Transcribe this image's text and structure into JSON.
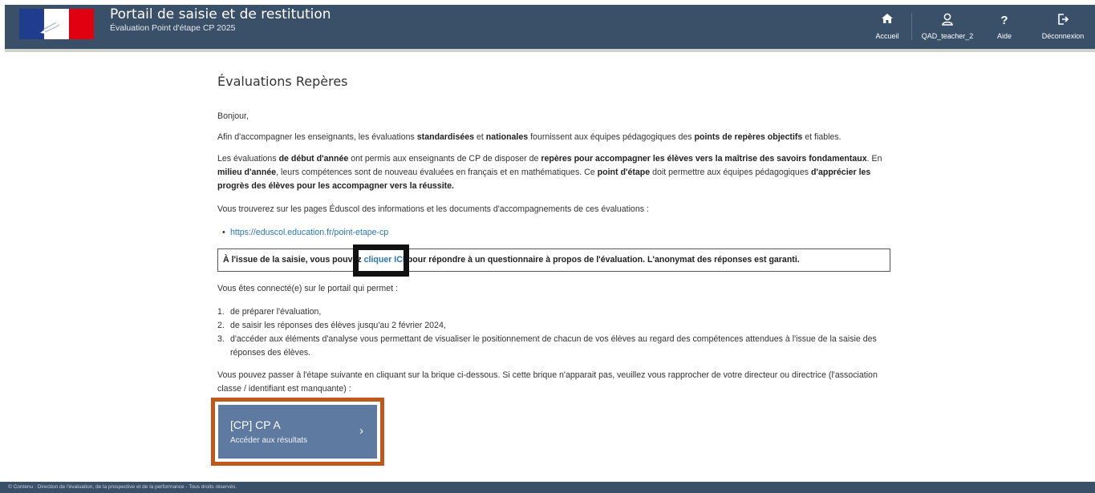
{
  "header": {
    "title": "Portail de saisie et de restitution",
    "subtitle": "Évaluation Point d'étape CP 2025",
    "nav": [
      {
        "label": "Accueil",
        "icon": "home-icon"
      },
      {
        "label": "QAD_teacher_2",
        "icon": "user-icon"
      },
      {
        "label": "Aide",
        "icon": "help-icon"
      },
      {
        "label": "Déconnexion",
        "icon": "logout-icon"
      }
    ],
    "colors": {
      "bar": "#3a4f68",
      "accent_link": "#2a76b7"
    }
  },
  "main": {
    "title": "Évaluations Repères",
    "greeting": "Bonjour,",
    "intro": {
      "p1": "Afin d'accompagner les enseignants, les évaluations ",
      "b1": "standardisées",
      "p2": " et ",
      "b2": "nationales",
      "p3": " fournissent aux équipes pédagogiques des ",
      "b3": "points de repères objectifs",
      "p4": " et fiables."
    },
    "para2": {
      "p1": "Les évaluations ",
      "b1": "de début d'année",
      "p2": " ont permis aux enseignants de CP de disposer de ",
      "b2": "repères pour accompagner les élèves vers la maîtrise des savoirs fondamentaux",
      "p3": ". En ",
      "b3": "milieu d'année",
      "p4": ", leurs compétences sont de nouveau évaluées en français et en mathématiques. Ce ",
      "b4": "point d'étape",
      "p5": " doit permettre aux équipes pédagogiques ",
      "b5": "d'apprécier les progrès des élèves pour les accompagner vers la réussite."
    },
    "eduscol_text": "Vous trouverez sur les pages Éduscol des informations et les documents d'accompagnements de ces évaluations :",
    "eduscol_link": "https://eduscol.education.fr/point-etape-cp",
    "survey": {
      "before": "À l'issue de la saisie, vous pouvez ",
      "link": "cliquer ICI",
      "after": " pour répondre à un questionnaire à propos de l'évaluation. L'anonymat des réponses est garanti."
    },
    "connected_intro": "Vous êtes connecté(e) sur le portail qui permet :",
    "steps": [
      {
        "num": "1.",
        "text": "de préparer l'évaluation,"
      },
      {
        "num": "2.",
        "text": "de saisir les réponses des élèves jusqu'au 2 février 2024,"
      },
      {
        "num": "3.",
        "text": "d'accéder aux éléments d'analyse vous permettant de visualiser le positionnement de chacun de vos élèves au regard des compétences attendues à l'issue de la saisie des réponses des élèves."
      }
    ],
    "next_step": "Vous pouvez passer à l'étape suivante en cliquant sur la brique ci-dessous. Si cette brique n'apparait pas, veuillez vous rapprocher de votre directeur ou directrice (l'association classe / identifiant est manquante) :",
    "class_card": {
      "title": "[CP] CP A",
      "subtitle": "Accéder aux résultats",
      "arrow": "›",
      "color": "#5e7aa0"
    }
  },
  "footer": {
    "text": "© Contenu : Direction de l'évaluation, de la prospective et de la performance - Tous droits réservés."
  }
}
